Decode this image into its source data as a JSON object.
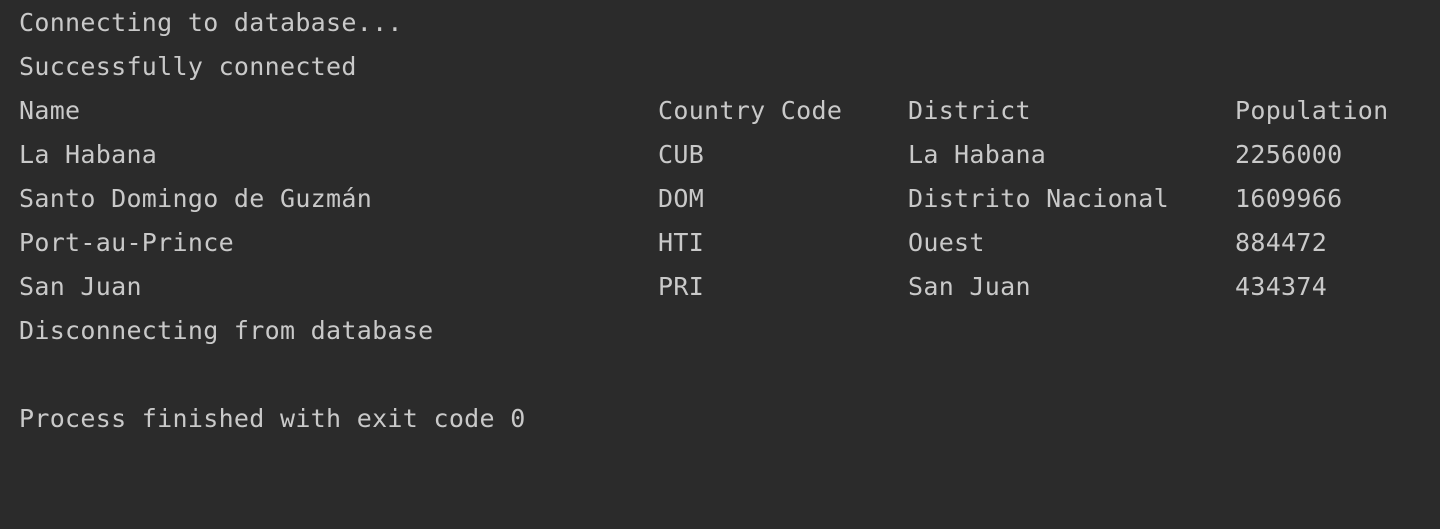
{
  "console": {
    "status_connecting": "Connecting to database...",
    "status_connected": "Successfully connected",
    "table": {
      "headers": [
        "Name",
        "Country Code",
        "District",
        "Population"
      ],
      "rows": [
        [
          "La Habana",
          "CUB",
          "La Habana",
          "2256000"
        ],
        [
          "Santo Domingo de Guzmán",
          "DOM",
          "Distrito Nacional",
          "1609966"
        ],
        [
          "Port-au-Prince",
          "HTI",
          "Ouest",
          "884472"
        ],
        [
          "San Juan",
          "PRI",
          "San Juan",
          "434374"
        ]
      ]
    },
    "status_disconnecting": "Disconnecting from database",
    "process_finished": "Process finished with exit code 0"
  }
}
